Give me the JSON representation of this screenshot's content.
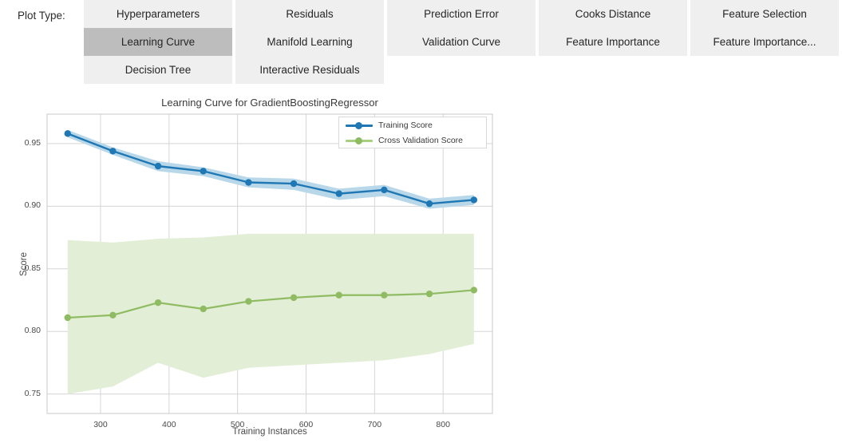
{
  "toolbar": {
    "label": "Plot Type:",
    "columns": [
      {
        "items": [
          {
            "label": "Hyperparameters",
            "selected": false
          },
          {
            "label": "Learning Curve",
            "selected": true
          },
          {
            "label": "Decision Tree",
            "selected": false
          }
        ]
      },
      {
        "items": [
          {
            "label": "Residuals",
            "selected": false
          },
          {
            "label": "Manifold Learning",
            "selected": false
          },
          {
            "label": "Interactive Residuals",
            "selected": false
          }
        ]
      },
      {
        "items": [
          {
            "label": "Prediction Error",
            "selected": false
          },
          {
            "label": "Validation Curve",
            "selected": false
          }
        ]
      },
      {
        "items": [
          {
            "label": "Cooks Distance",
            "selected": false
          },
          {
            "label": "Feature Importance",
            "selected": false
          }
        ]
      },
      {
        "items": [
          {
            "label": "Feature Selection",
            "selected": false
          },
          {
            "label": "Feature Importance...",
            "selected": false
          }
        ]
      }
    ]
  },
  "colors": {
    "training_line": "#1f77b4",
    "training_band": "#b8d8ea",
    "cv_line": "#8fbc62",
    "cv_band": "#e3eed7",
    "grid": "#d5d5d5",
    "axis": "#c8c8c8",
    "tab_bg": "#efefef",
    "tab_selected_bg": "#bdbdbd"
  },
  "chart_data": {
    "type": "line",
    "title": "Learning Curve for GradientBoostingRegressor",
    "xlabel": "Training Instances",
    "ylabel": "Score",
    "xlim": [
      222,
      872
    ],
    "ylim": [
      0.7345,
      0.9735
    ],
    "xticks": [
      300,
      400,
      500,
      600,
      700,
      800
    ],
    "yticks": [
      0.95,
      0.9,
      0.85,
      0.8,
      0.75
    ],
    "ytick_labels": [
      "0.95",
      "0.90",
      "0.85",
      "0.80",
      "0.75"
    ],
    "xtick_labels": [
      "300",
      "400",
      "500",
      "600",
      "700",
      "800"
    ],
    "grid": true,
    "legend_position": "upper right",
    "x": [
      252,
      318,
      384,
      450,
      516,
      582,
      648,
      714,
      780,
      845
    ],
    "series": [
      {
        "name": "Training Score",
        "color": "#1f77b4",
        "band_color": "#b8d8ea",
        "values": [
          0.958,
          0.944,
          0.932,
          0.928,
          0.919,
          0.918,
          0.91,
          0.913,
          0.902,
          0.905
        ],
        "band_upper": [
          0.961,
          0.947,
          0.936,
          0.931,
          0.923,
          0.922,
          0.914,
          0.917,
          0.906,
          0.909
        ],
        "band_lower": [
          0.955,
          0.941,
          0.928,
          0.924,
          0.915,
          0.913,
          0.905,
          0.908,
          0.898,
          0.901
        ]
      },
      {
        "name": "Cross Validation Score",
        "color": "#8fbc62",
        "band_color": "#e3eed7",
        "values": [
          0.811,
          0.813,
          0.823,
          0.818,
          0.824,
          0.827,
          0.829,
          0.829,
          0.83,
          0.833
        ],
        "band_upper": [
          0.873,
          0.871,
          0.874,
          0.875,
          0.878,
          0.878,
          0.878,
          0.878,
          0.878,
          0.878
        ],
        "band_lower": [
          0.75,
          0.756,
          0.775,
          0.763,
          0.771,
          0.773,
          0.775,
          0.777,
          0.782,
          0.79
        ]
      }
    ]
  }
}
